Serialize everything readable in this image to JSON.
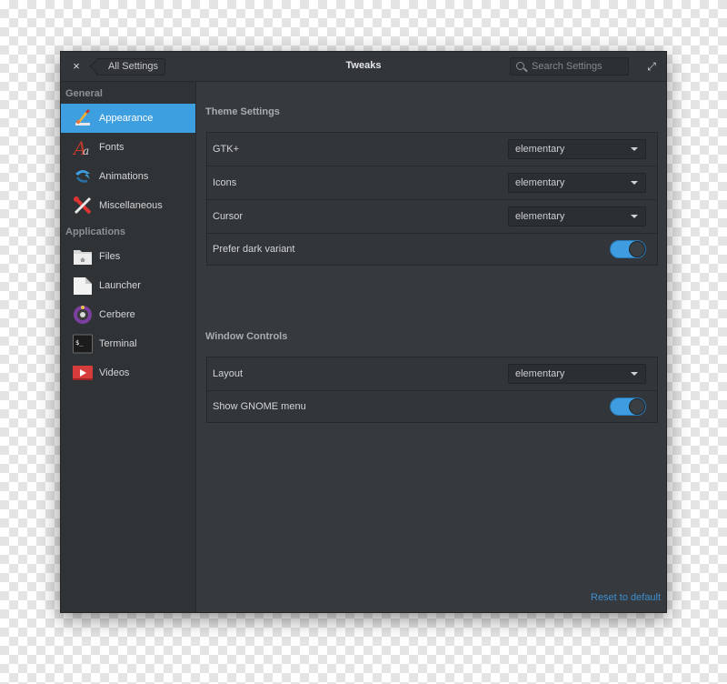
{
  "window": {
    "title": "Tweaks",
    "close_label": "×",
    "back_label": "All Settings",
    "search_placeholder": "Search Settings",
    "maximize_label": "⤢"
  },
  "sidebar": {
    "general_heading": "General",
    "applications_heading": "Applications",
    "general_items": [
      {
        "label": "Appearance",
        "icon": "paint-brush-icon",
        "selected": true
      },
      {
        "label": "Fonts",
        "icon": "fonts-icon"
      },
      {
        "label": "Animations",
        "icon": "animations-icon"
      },
      {
        "label": "Miscellaneous",
        "icon": "tools-icon"
      }
    ],
    "application_items": [
      {
        "label": "Files",
        "icon": "folder-icon"
      },
      {
        "label": "Launcher",
        "icon": "launcher-icon"
      },
      {
        "label": "Cerbere",
        "icon": "cerbere-icon"
      },
      {
        "label": "Terminal",
        "icon": "terminal-icon",
        "glyph": "$_"
      },
      {
        "label": "Videos",
        "icon": "videos-icon"
      }
    ]
  },
  "theme_settings": {
    "title": "Theme Settings",
    "rows": [
      {
        "label": "GTK+",
        "value": "elementary"
      },
      {
        "label": "Icons",
        "value": "elementary"
      },
      {
        "label": "Cursor",
        "value": "elementary"
      }
    ],
    "dark_variant": {
      "label": "Prefer dark variant",
      "enabled": true
    }
  },
  "window_controls": {
    "title": "Window Controls",
    "layout": {
      "label": "Layout",
      "value": "elementary"
    },
    "gnome_menu": {
      "label": "Show GNOME menu",
      "enabled": true
    }
  },
  "footer": {
    "reset_label": "Reset to default"
  },
  "colors": {
    "accent": "#3d9ee0",
    "window_bg": "#363a3e",
    "sidebar_bg": "#2f3336",
    "link": "#3d8fd0"
  }
}
